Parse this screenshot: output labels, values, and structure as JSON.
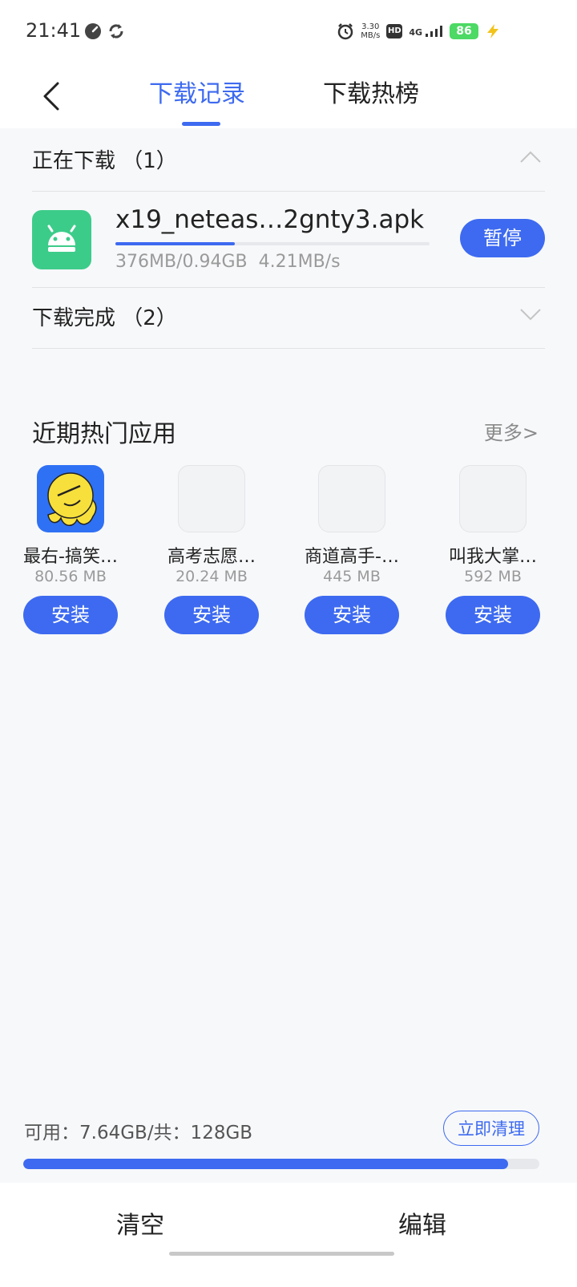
{
  "status": {
    "time": "21:41",
    "net_speed_value": "3.30",
    "net_speed_unit": "MB/s",
    "hd": "HD",
    "network": "4G",
    "battery": "86"
  },
  "nav": {
    "tab_records": "下载记录",
    "tab_hot": "下载热榜"
  },
  "downloading": {
    "title": "正在下载 （1）",
    "file_name": "x19_neteas…2gnty3.apk",
    "progress": 0.38,
    "size_info": "376MB/0.94GB",
    "speed": "4.21MB/s",
    "pause_label": "暂停"
  },
  "completed": {
    "title": "下载完成 （2）"
  },
  "hot_apps": {
    "title": "近期热门应用",
    "more": "更多>",
    "install_label": "安装",
    "items": [
      {
        "name": "最右-搞笑…",
        "size": "80.56 MB"
      },
      {
        "name": "高考志愿…",
        "size": "20.24 MB"
      },
      {
        "name": "商道高手-…",
        "size": "445 MB"
      },
      {
        "name": "叫我大掌…",
        "size": "592 MB"
      }
    ]
  },
  "storage": {
    "text": "可用：7.64GB/共：128GB",
    "used_fraction": 0.94,
    "clean_label": "立即清理"
  },
  "bottom": {
    "clear": "清空",
    "edit": "编辑"
  },
  "colors": {
    "accent": "#3d6af0",
    "android_green": "#3ccc8a",
    "battery_green": "#4cd964"
  }
}
